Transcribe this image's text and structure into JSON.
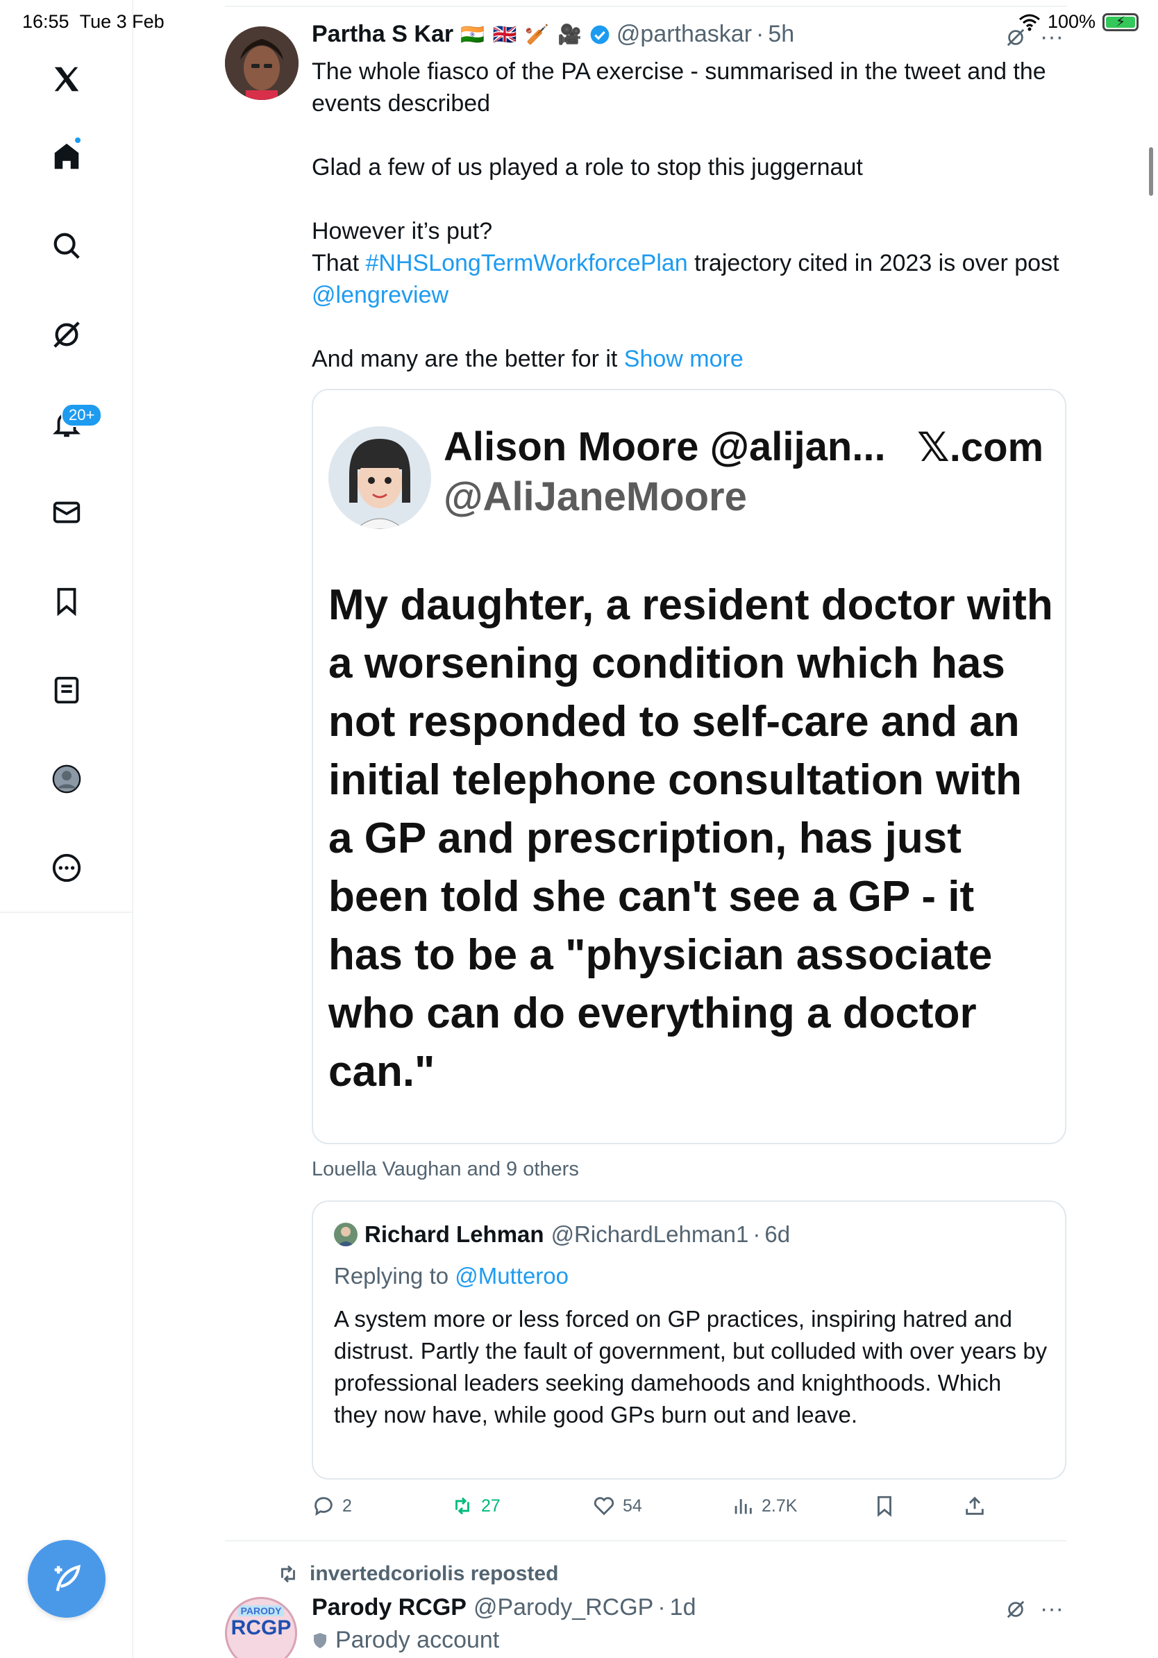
{
  "status_bar": {
    "time": "16:55",
    "date": "Tue 3 Feb",
    "battery": "100%"
  },
  "sidebar": {
    "items": [
      {
        "icon": "x-logo-icon"
      },
      {
        "icon": "home-icon"
      },
      {
        "icon": "search-icon"
      },
      {
        "icon": "grok-icon"
      },
      {
        "icon": "bell-icon"
      },
      {
        "icon": "mail-icon"
      },
      {
        "icon": "bookmark-icon"
      },
      {
        "icon": "list-icon"
      },
      {
        "icon": "profile-icon"
      },
      {
        "icon": "more-icon"
      }
    ],
    "notifications_badge": "20+",
    "compose_icon": "compose-icon"
  },
  "tweet": {
    "author_name": "Partha S Kar",
    "author_flags": "🇮🇳 🇬🇧 🏏 🎥",
    "author_handle": "@parthaskar",
    "time": "5h",
    "line1": "The whole fiasco of the PA exercise - summarised in the tweet and the events described",
    "line2": "Glad a few of us played a role to stop this juggernaut",
    "line3": "However it’s put?",
    "line4_pre": "That ",
    "line4_hashtag": "#NHSLongTermWorkforcePlan",
    "line4_post": " trajectory cited in 2023 is over post ",
    "line4_mention": "@lengreview",
    "line5": "And many are the better for it ",
    "show_more": "Show more",
    "image": {
      "name_line": "Alison Moore @alijan...",
      "handle_line": "@AliJaneMoore",
      "source": "𝕏.com",
      "quote": "My daughter, a resident doctor with a worsening condition which has not responded to self-care and an initial telephone consultation with a GP and prescription, has just been told she can't see a GP - it has to be a \"physician associate who can do everything a doctor can.\""
    },
    "liked_by": "Louella Vaughan and 9 others",
    "quoted": {
      "name": "Richard Lehman",
      "handle": "@RichardLehman1",
      "time": "6d",
      "replying_label": "Replying to ",
      "replying_to": "@Mutteroo",
      "body": "A system more or less forced on GP practices, inspiring hatred and distrust. Partly the fault of government, but colluded with over years by professional leaders seeking damehoods and knighthoods. Which they now have, while good GPs burn out and leave."
    },
    "actions": {
      "replies": "2",
      "reposts": "27",
      "likes": "54",
      "views": "2.7K"
    }
  },
  "next_tweet": {
    "repost_by": "invertedcoriolis reposted",
    "author_name": "Parody RCGP",
    "author_handle": "@Parody_RCGP",
    "time": "1d",
    "sub_label": "Parody account",
    "avatar_top": "PARODY",
    "avatar_main": "RCGP"
  },
  "colors": {
    "link": "#1d9bf0",
    "repost_green": "#00ba7c",
    "compose_bg": "#4a99e9"
  }
}
